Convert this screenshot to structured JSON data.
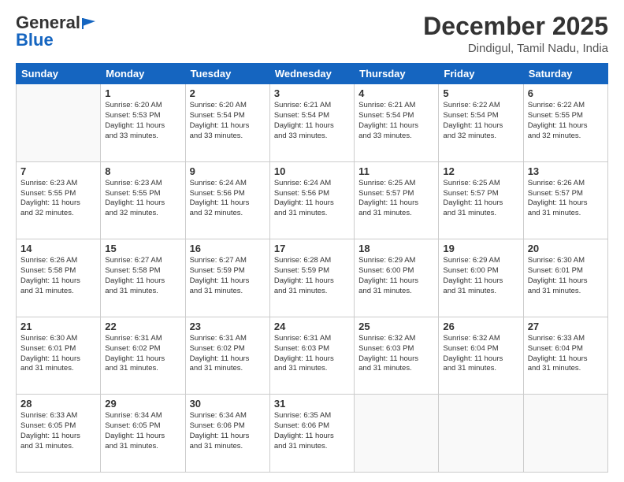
{
  "header": {
    "logo_general": "General",
    "logo_blue": "Blue",
    "title": "December 2025",
    "location": "Dindigul, Tamil Nadu, India"
  },
  "weekdays": [
    "Sunday",
    "Monday",
    "Tuesday",
    "Wednesday",
    "Thursday",
    "Friday",
    "Saturday"
  ],
  "weeks": [
    [
      {
        "day": "",
        "info": ""
      },
      {
        "day": "1",
        "info": "Sunrise: 6:20 AM\nSunset: 5:53 PM\nDaylight: 11 hours\nand 33 minutes."
      },
      {
        "day": "2",
        "info": "Sunrise: 6:20 AM\nSunset: 5:54 PM\nDaylight: 11 hours\nand 33 minutes."
      },
      {
        "day": "3",
        "info": "Sunrise: 6:21 AM\nSunset: 5:54 PM\nDaylight: 11 hours\nand 33 minutes."
      },
      {
        "day": "4",
        "info": "Sunrise: 6:21 AM\nSunset: 5:54 PM\nDaylight: 11 hours\nand 33 minutes."
      },
      {
        "day": "5",
        "info": "Sunrise: 6:22 AM\nSunset: 5:54 PM\nDaylight: 11 hours\nand 32 minutes."
      },
      {
        "day": "6",
        "info": "Sunrise: 6:22 AM\nSunset: 5:55 PM\nDaylight: 11 hours\nand 32 minutes."
      }
    ],
    [
      {
        "day": "7",
        "info": "Sunrise: 6:23 AM\nSunset: 5:55 PM\nDaylight: 11 hours\nand 32 minutes."
      },
      {
        "day": "8",
        "info": "Sunrise: 6:23 AM\nSunset: 5:55 PM\nDaylight: 11 hours\nand 32 minutes."
      },
      {
        "day": "9",
        "info": "Sunrise: 6:24 AM\nSunset: 5:56 PM\nDaylight: 11 hours\nand 32 minutes."
      },
      {
        "day": "10",
        "info": "Sunrise: 6:24 AM\nSunset: 5:56 PM\nDaylight: 11 hours\nand 31 minutes."
      },
      {
        "day": "11",
        "info": "Sunrise: 6:25 AM\nSunset: 5:57 PM\nDaylight: 11 hours\nand 31 minutes."
      },
      {
        "day": "12",
        "info": "Sunrise: 6:25 AM\nSunset: 5:57 PM\nDaylight: 11 hours\nand 31 minutes."
      },
      {
        "day": "13",
        "info": "Sunrise: 6:26 AM\nSunset: 5:57 PM\nDaylight: 11 hours\nand 31 minutes."
      }
    ],
    [
      {
        "day": "14",
        "info": "Sunrise: 6:26 AM\nSunset: 5:58 PM\nDaylight: 11 hours\nand 31 minutes."
      },
      {
        "day": "15",
        "info": "Sunrise: 6:27 AM\nSunset: 5:58 PM\nDaylight: 11 hours\nand 31 minutes."
      },
      {
        "day": "16",
        "info": "Sunrise: 6:27 AM\nSunset: 5:59 PM\nDaylight: 11 hours\nand 31 minutes."
      },
      {
        "day": "17",
        "info": "Sunrise: 6:28 AM\nSunset: 5:59 PM\nDaylight: 11 hours\nand 31 minutes."
      },
      {
        "day": "18",
        "info": "Sunrise: 6:29 AM\nSunset: 6:00 PM\nDaylight: 11 hours\nand 31 minutes."
      },
      {
        "day": "19",
        "info": "Sunrise: 6:29 AM\nSunset: 6:00 PM\nDaylight: 11 hours\nand 31 minutes."
      },
      {
        "day": "20",
        "info": "Sunrise: 6:30 AM\nSunset: 6:01 PM\nDaylight: 11 hours\nand 31 minutes."
      }
    ],
    [
      {
        "day": "21",
        "info": "Sunrise: 6:30 AM\nSunset: 6:01 PM\nDaylight: 11 hours\nand 31 minutes."
      },
      {
        "day": "22",
        "info": "Sunrise: 6:31 AM\nSunset: 6:02 PM\nDaylight: 11 hours\nand 31 minutes."
      },
      {
        "day": "23",
        "info": "Sunrise: 6:31 AM\nSunset: 6:02 PM\nDaylight: 11 hours\nand 31 minutes."
      },
      {
        "day": "24",
        "info": "Sunrise: 6:31 AM\nSunset: 6:03 PM\nDaylight: 11 hours\nand 31 minutes."
      },
      {
        "day": "25",
        "info": "Sunrise: 6:32 AM\nSunset: 6:03 PM\nDaylight: 11 hours\nand 31 minutes."
      },
      {
        "day": "26",
        "info": "Sunrise: 6:32 AM\nSunset: 6:04 PM\nDaylight: 11 hours\nand 31 minutes."
      },
      {
        "day": "27",
        "info": "Sunrise: 6:33 AM\nSunset: 6:04 PM\nDaylight: 11 hours\nand 31 minutes."
      }
    ],
    [
      {
        "day": "28",
        "info": "Sunrise: 6:33 AM\nSunset: 6:05 PM\nDaylight: 11 hours\nand 31 minutes."
      },
      {
        "day": "29",
        "info": "Sunrise: 6:34 AM\nSunset: 6:05 PM\nDaylight: 11 hours\nand 31 minutes."
      },
      {
        "day": "30",
        "info": "Sunrise: 6:34 AM\nSunset: 6:06 PM\nDaylight: 11 hours\nand 31 minutes."
      },
      {
        "day": "31",
        "info": "Sunrise: 6:35 AM\nSunset: 6:06 PM\nDaylight: 11 hours\nand 31 minutes."
      },
      {
        "day": "",
        "info": ""
      },
      {
        "day": "",
        "info": ""
      },
      {
        "day": "",
        "info": ""
      }
    ]
  ]
}
